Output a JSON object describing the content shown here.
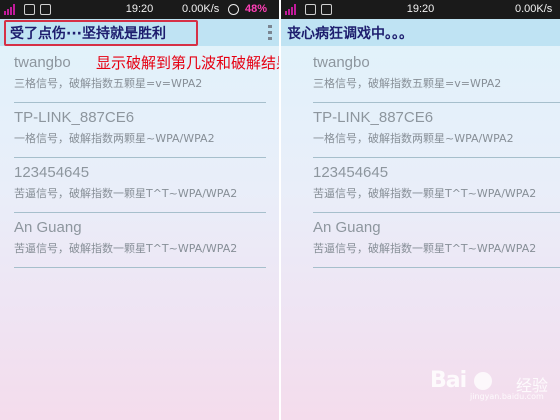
{
  "colors": {
    "status_bar": "#1a1a1a",
    "app_bar": "#bfe3f3",
    "title_text": "#1d1d6e",
    "annotation": "#e60012",
    "highlight_border": "#d63046",
    "battery": "#ff3fb6"
  },
  "left_screen": {
    "status": {
      "time": "19:20",
      "speed": "0.00K/s",
      "battery": "48%"
    },
    "title": "受了点伤···坚持就是胜利",
    "networks": [
      {
        "ssid": "twangbo",
        "info": "三格信号，破解指数五颗星=v=WPA2"
      },
      {
        "ssid": "TP-LINK_887CE6",
        "info": "一格信号，破解指数两颗星~WPA/WPA2"
      },
      {
        "ssid": "123454645",
        "info": "苦逼信号，破解指数一颗星T^T~WPA/WPA2"
      },
      {
        "ssid": "An Guang",
        "info": "苦逼信号，破解指数一颗星T^T~WPA/WPA2"
      }
    ]
  },
  "right_screen": {
    "status": {
      "time": "19:20",
      "speed": "0.00K/s"
    },
    "title": "丧心病狂调戏中。。。",
    "networks": [
      {
        "ssid": "twangbo",
        "info": "三格信号，破解指数五颗星=v=WPA2"
      },
      {
        "ssid": "TP-LINK_887CE6",
        "info": "一格信号，破解指数两颗星~WPA/WPA2"
      },
      {
        "ssid": "123454645",
        "info": "苦逼信号，破解指数一颗星T^T~WPA/WPA2"
      },
      {
        "ssid": "An Guang",
        "info": "苦逼信号，破解指数一颗星T^T~WPA/WPA2"
      }
    ]
  },
  "annotation": "显示破解到第几波和破解结果",
  "watermark": {
    "brand_a": "Bai",
    "brand_b": "经验",
    "url": "jingyan.baidu.com"
  },
  "icons": [
    "signal-icon",
    "notification-icon",
    "image-icon",
    "alarm-icon",
    "overflow-menu-icon",
    "baidu-paw-icon"
  ]
}
